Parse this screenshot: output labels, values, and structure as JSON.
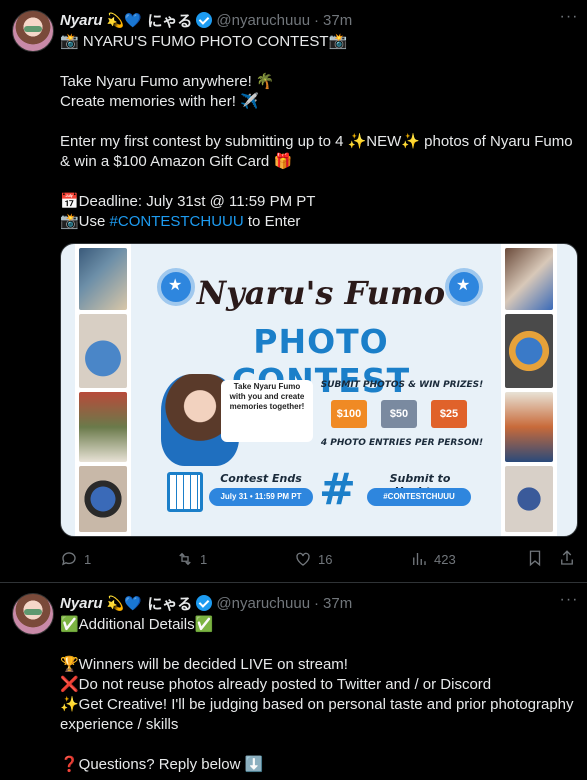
{
  "tweets": [
    {
      "display_name": "Nyaru",
      "emoji": "💫💙",
      "jp_name": "にゃる",
      "handle": "@nyaruchuuu",
      "separator": "·",
      "time": "37m",
      "lines": [
        "📸 NYARU'S FUMO PHOTO CONTEST📸",
        "",
        "Take Nyaru Fumo anywhere! 🌴",
        "Create memories with her! ✈️",
        "",
        "Enter my first contest by submitting up to 4 ✨NEW✨ photos of Nyaru Fumo",
        "& win a $100 Amazon Gift Card 🎁",
        "",
        "📅Deadline: July 31st @ 11:59 PM PT"
      ],
      "use_prefix": "📸Use ",
      "hashtag": "#CONTESTCHUUU",
      "use_suffix": " to Enter",
      "poster": {
        "title": "Nyaru's Fumo",
        "subtitle": "PHOTO CONTEST",
        "take_text": "Take Nyaru Fumo with you and create memories together!",
        "submit_text": "SUBMIT PHOTOS & WIN PRIZES!",
        "prizes": [
          "$100",
          "$50",
          "$25"
        ],
        "entries_text": "4 PHOTO ENTRIES PER PERSON!",
        "ends_label": "Contest Ends",
        "ends_value": "July 31 • 11:59 PM PT",
        "submit_label": "Submit to Hashtag",
        "submit_value": "#CONTESTCHUUU",
        "hash_symbol": "#"
      },
      "actions": {
        "replies": "1",
        "retweets": "1",
        "likes": "16",
        "views": "423"
      }
    },
    {
      "display_name": "Nyaru",
      "emoji": "💫💙",
      "jp_name": "にゃる",
      "handle": "@nyaruchuuu",
      "separator": "·",
      "time": "37m",
      "lines": [
        "✅Additional Details✅",
        "",
        "🏆Winners will be decided LIVE on stream!",
        "❌Do not reuse photos already posted to Twitter and / or Discord",
        "✨Get Creative! I'll be judging based on personal taste and prior photography",
        "experience / skills",
        "",
        "❓Questions? Reply below ⬇️"
      ]
    }
  ],
  "colors": {
    "background": "#000000",
    "text": "#e7e9ea",
    "muted": "#71767b",
    "accent": "#1d9bf0",
    "poster_blue": "#1b7fc9"
  }
}
